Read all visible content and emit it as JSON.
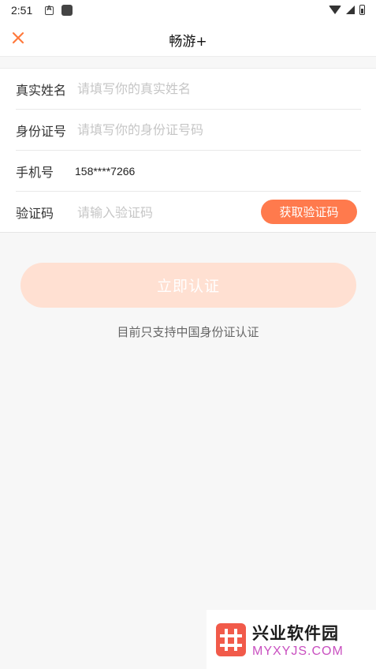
{
  "status_bar": {
    "time": "2:51",
    "icons": [
      "notification-icon",
      "app-icon",
      "wifi-icon",
      "signal-icon",
      "battery-icon"
    ]
  },
  "nav": {
    "title": "畅游+",
    "close_icon": "close-icon",
    "accent_color": "#ff7a3d"
  },
  "form": {
    "name": {
      "label": "真实姓名",
      "placeholder": "请填写你的真实姓名"
    },
    "id_card": {
      "label": "身份证号",
      "placeholder": "请填写你的身份证号码"
    },
    "phone": {
      "label": "手机号",
      "value": "158****7266"
    },
    "code": {
      "label": "验证码",
      "placeholder": "请输入验证码",
      "button_label": "获取验证码"
    }
  },
  "submit": {
    "label": "立即认证"
  },
  "note": "目前只支持中国身份证认证",
  "watermark": {
    "cn": "兴业软件园",
    "en": "MYXYJS.COM"
  },
  "colors": {
    "primary": "#ff7a4d",
    "primary_disabled": "#ffe0d2",
    "background": "#f7f7f7"
  }
}
